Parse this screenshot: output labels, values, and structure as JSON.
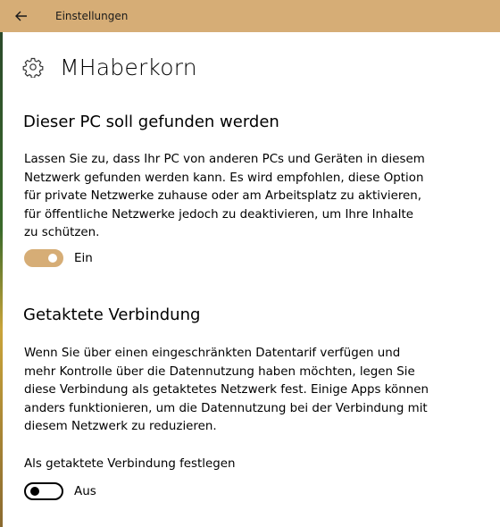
{
  "window": {
    "title": "Einstellungen",
    "back_icon": "arrow-left-icon"
  },
  "header": {
    "icon": "gear-icon",
    "title": "MHaberkorn"
  },
  "discovery": {
    "heading": "Dieser PC soll gefunden werden",
    "description_lines": [
      "Lassen Sie zu, dass Ihr PC von anderen PCs und Geräten in diesem",
      "Netzwerk gefunden werden kann. Es wird empfohlen, diese Option",
      "für private Netzwerke zuhause oder am Arbeitsplatz zu aktivieren,",
      "für öffentliche Netzwerke jedoch zu deaktivieren, um Ihre Inhalte",
      "zu schützen."
    ],
    "toggle_state": "on",
    "toggle_label": "Ein"
  },
  "metered": {
    "heading": "Getaktete Verbindung",
    "description_lines": [
      "Wenn Sie über einen eingeschränkten Datentarif verfügen und",
      "mehr Kontrolle über die Datennutzung haben möchten, legen Sie",
      "diese Verbindung als getaktetes Netzwerk fest. Einige Apps können",
      "anders funktionieren, um die Datennutzung bei der Verbindung mit",
      "diesem Netzwerk zu reduzieren."
    ],
    "setting_label": "Als getaktete Verbindung festlegen",
    "toggle_state": "off",
    "toggle_label": "Aus"
  },
  "colors": {
    "accent": "#d6ad76",
    "background": "#ffffff",
    "text": "#000000"
  }
}
